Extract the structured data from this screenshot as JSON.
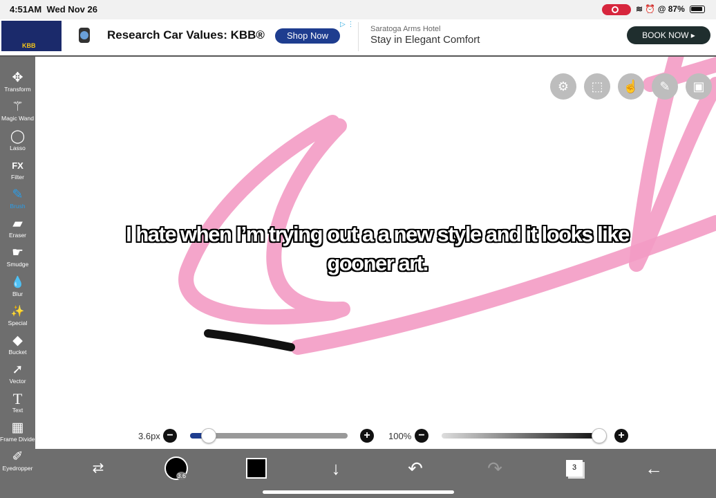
{
  "status": {
    "time": "4:51AM",
    "date": "Wed Nov 26",
    "battery": "87%"
  },
  "ad1": {
    "thumb_text": "KBB",
    "title": "Research Car Values: KBB®",
    "cta": "Shop Now"
  },
  "ad2": {
    "sponsor": "Saratoga Arms Hotel",
    "title": "Stay in Elegant Comfort",
    "cta": "BOOK NOW ▸"
  },
  "tools": [
    {
      "label": "Transform",
      "icon": "✥"
    },
    {
      "label": "Magic Wand",
      "icon": "⚚"
    },
    {
      "label": "Lasso",
      "icon": "◯"
    },
    {
      "label": "Filter",
      "icon": "FX"
    },
    {
      "label": "Brush",
      "icon": "✎"
    },
    {
      "label": "Eraser",
      "icon": "▰"
    },
    {
      "label": "Smudge",
      "icon": "☛"
    },
    {
      "label": "Blur",
      "icon": "💧"
    },
    {
      "label": "Special",
      "icon": "✨"
    },
    {
      "label": "Bucket",
      "icon": "◆"
    },
    {
      "label": "Vector",
      "icon": "➚"
    },
    {
      "label": "Text",
      "icon": "T"
    },
    {
      "label": "Frame Divider",
      "icon": "▦"
    },
    {
      "label": "Eyedropper",
      "icon": "✐"
    }
  ],
  "active_tool": "Brush",
  "caption": {
    "line1": "I hate when I’m trying out a a new style and it looks like",
    "line2": "gooner art."
  },
  "brush": {
    "size_label": "3.6px",
    "size_value": 3.6,
    "opacity_label": "100%",
    "opacity_value": 1.0,
    "size_fraction": 0.12
  },
  "bottom": {
    "brush_size_badge": "3.6",
    "layer_count": "3"
  },
  "colors": {
    "toolbar": "#6e6e6e",
    "stroke": "#f39bc4",
    "primary": "#000000",
    "active": "#2b9de8"
  }
}
